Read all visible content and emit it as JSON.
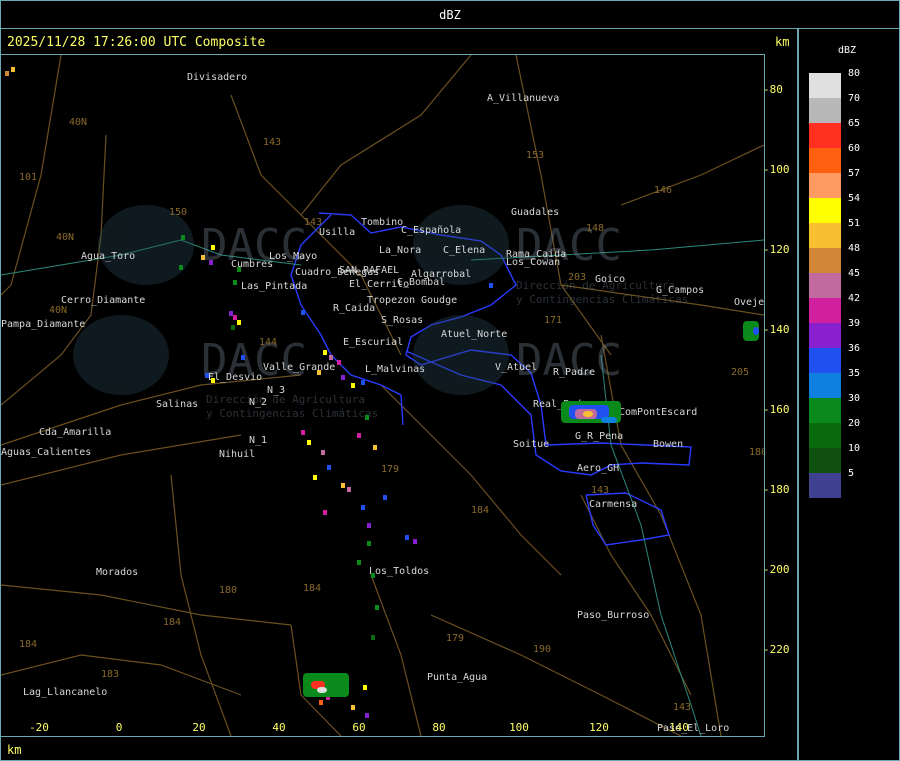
{
  "window_title": "dBZ",
  "header": "2025/11/28 17:26:00 UTC Composite",
  "km_label": "km",
  "legend": {
    "title": "dBZ",
    "entries": [
      {
        "value": "80",
        "color": "#e0e0e0"
      },
      {
        "value": "70",
        "color": "#b8b8b8"
      },
      {
        "value": "65",
        "color": "#ff3020"
      },
      {
        "value": "60",
        "color": "#ff6010"
      },
      {
        "value": "57",
        "color": "#ff9a60"
      },
      {
        "value": "54",
        "color": "#ffff00"
      },
      {
        "value": "51",
        "color": "#f8c030"
      },
      {
        "value": "48",
        "color": "#d08838"
      },
      {
        "value": "45",
        "color": "#c06aa0"
      },
      {
        "value": "42",
        "color": "#d020a0"
      },
      {
        "value": "39",
        "color": "#8820d0"
      },
      {
        "value": "36",
        "color": "#2050f0"
      },
      {
        "value": "35",
        "color": "#1080e0"
      },
      {
        "value": "30",
        "color": "#0a8a1a"
      },
      {
        "value": "20",
        "color": "#0a6a10"
      },
      {
        "value": "10",
        "color": "#105010"
      },
      {
        "value": "5",
        "color": "#404090"
      }
    ]
  },
  "x_ticks": [
    "-20",
    "0",
    "20",
    "40",
    "60",
    "80",
    "100",
    "120",
    "140"
  ],
  "y_ticks": [
    "-80",
    "-100",
    "-120",
    "-140",
    "-160",
    "-180",
    "-200",
    "-220"
  ],
  "places": [
    "Divisadero",
    "A_Villanueva",
    "Tombino",
    "C_Española",
    "Usilla",
    "La_Nora",
    "Guadales",
    "C_Elena",
    "Rama_Caida",
    "Los_Cowan",
    "Goudge",
    "Agua_Toro",
    "Los_Mayo",
    "Cuadro_Benegas",
    "SAN_RAFAEL",
    "Algarrobal",
    "El_Cerrito",
    "Cumbres",
    "Las_Pintada",
    "R_Caida",
    "Tropezon",
    "C_Bombal",
    "Goico",
    "G_Campos",
    "Ovejeria",
    "Pampa_Diamante",
    "Cerro_Diamante",
    "S_Rosas",
    "Atuel_Norte",
    "E_Escurial",
    "Valle_Grande",
    "L_Malvinas",
    "El_Desvio",
    "Salinas",
    "N_3",
    "N_2",
    "N_1",
    "Nihuil",
    "V_Atuel",
    "R_Padre",
    "Real_Padre",
    "ComPontEscard",
    "G_R_Pena",
    "Bowen",
    "Soitue",
    "Aero_GH",
    "Carmensa",
    "Cda_Amarilla",
    "Aguas_Calientes",
    "Morados",
    "Los_Toldos",
    "Paso_Burroso",
    "Punta_Agua",
    "Lag_Llancanelo",
    "Paso_El_Loro"
  ],
  "watermark": {
    "brand": "DACC",
    "line1": "Dirección de Agricultura",
    "line2": "y Contingencias Climáticas"
  },
  "colors": {
    "frame": "#6aa6b3",
    "axis": "#ffff66",
    "boundary": "#2a3aff",
    "road": "#8a6a2a"
  }
}
